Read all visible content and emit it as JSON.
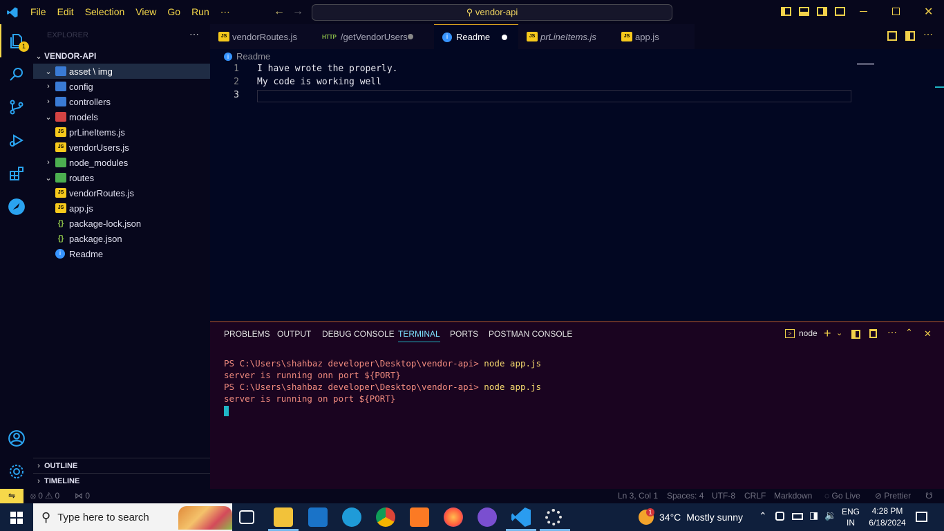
{
  "menu": {
    "items": [
      "File",
      "Edit",
      "Selection",
      "View",
      "Go",
      "Run",
      "⋯"
    ]
  },
  "search": {
    "label": "vendor-api"
  },
  "activity": {
    "badge": "1"
  },
  "sidebar": {
    "header": "EXPLORER",
    "project": "VENDOR-API",
    "items": [
      {
        "label": "asset \\ img",
        "depth": 1,
        "chevron": "⌄",
        "icon": "folder-icon"
      },
      {
        "label": "config",
        "depth": 1,
        "chevron": "›",
        "icon": "folder-icon"
      },
      {
        "label": "controllers",
        "depth": 1,
        "chevron": "›",
        "icon": "folder-icon"
      },
      {
        "label": "models",
        "depth": 1,
        "chevron": "⌄",
        "icon": "folder-red"
      },
      {
        "label": "prLineItems.js",
        "depth": 2,
        "chevron": "",
        "icon": "js-icon"
      },
      {
        "label": "vendorUsers.js",
        "depth": 2,
        "chevron": "",
        "icon": "js-icon"
      },
      {
        "label": "node_modules",
        "depth": 1,
        "chevron": "›",
        "icon": "folder-green"
      },
      {
        "label": "routes",
        "depth": 1,
        "chevron": "⌄",
        "icon": "folder-green"
      },
      {
        "label": "vendorRoutes.js",
        "depth": 2,
        "chevron": "",
        "icon": "js-icon"
      },
      {
        "label": "app.js",
        "depth": 1,
        "chevron": "",
        "icon": "js-icon"
      },
      {
        "label": "package-lock.json",
        "depth": 1,
        "chevron": "",
        "icon": "json-icon"
      },
      {
        "label": "package.json",
        "depth": 1,
        "chevron": "",
        "icon": "json-icon"
      },
      {
        "label": "Readme",
        "depth": 1,
        "chevron": "",
        "icon": "info-icon"
      }
    ],
    "outline": "OUTLINE",
    "timeline": "TIMELINE"
  },
  "tabs": [
    {
      "label": "vendorRoutes.js",
      "icon": "JS"
    },
    {
      "label": "/getVendorUsers",
      "icon": "HTTP"
    },
    {
      "label": "Readme",
      "icon": "i"
    },
    {
      "label": "prLineItems.js",
      "icon": "JS"
    },
    {
      "label": "app.js",
      "icon": "JS"
    }
  ],
  "editor": {
    "breadcrumb": "Readme",
    "lines": [
      {
        "num": "1",
        "text": "I have wrote the properly."
      },
      {
        "num": "2",
        "text": "My code is working well"
      },
      {
        "num": "3",
        "text": ""
      }
    ]
  },
  "panel": {
    "tabs": [
      "PROBLEMS",
      "OUTPUT",
      "DEBUG CONSOLE",
      "TERMINAL",
      "PORTS",
      "POSTMAN CONSOLE"
    ],
    "terminal_name": "node",
    "lines": [
      {
        "prompt": "PS C:\\Users\\shahbaz developer\\Desktop\\vendor-api> ",
        "cmd": "node app.js"
      },
      {
        "prompt": "server is running onn port ${PORT}",
        "cmd": ""
      },
      {
        "prompt": "PS C:\\Users\\shahbaz developer\\Desktop\\vendor-api> ",
        "cmd": "node app.js"
      },
      {
        "prompt": "server is running on port ${PORT}",
        "cmd": ""
      }
    ]
  },
  "status": {
    "errors": "0",
    "warnings": "0",
    "ports": "0",
    "position": "Ln 3, Col 1",
    "spaces": "Spaces: 4",
    "encoding": "UTF-8",
    "eol": "CRLF",
    "language": "Markdown",
    "golive": "Go Live",
    "prettier": "Prettier"
  },
  "taskbar": {
    "search_placeholder": "Type here to search",
    "weather_temp": "34°C",
    "weather_desc": "Mostly sunny",
    "weather_badge": "1",
    "lang_top": "ENG",
    "lang_bottom": "IN",
    "time": "4:28 PM",
    "date": "6/18/2024"
  },
  "colors": {
    "accent": "#f6d84a",
    "terminal_text": "#f08a7e",
    "active_tab_border": "#1fb6c6"
  }
}
